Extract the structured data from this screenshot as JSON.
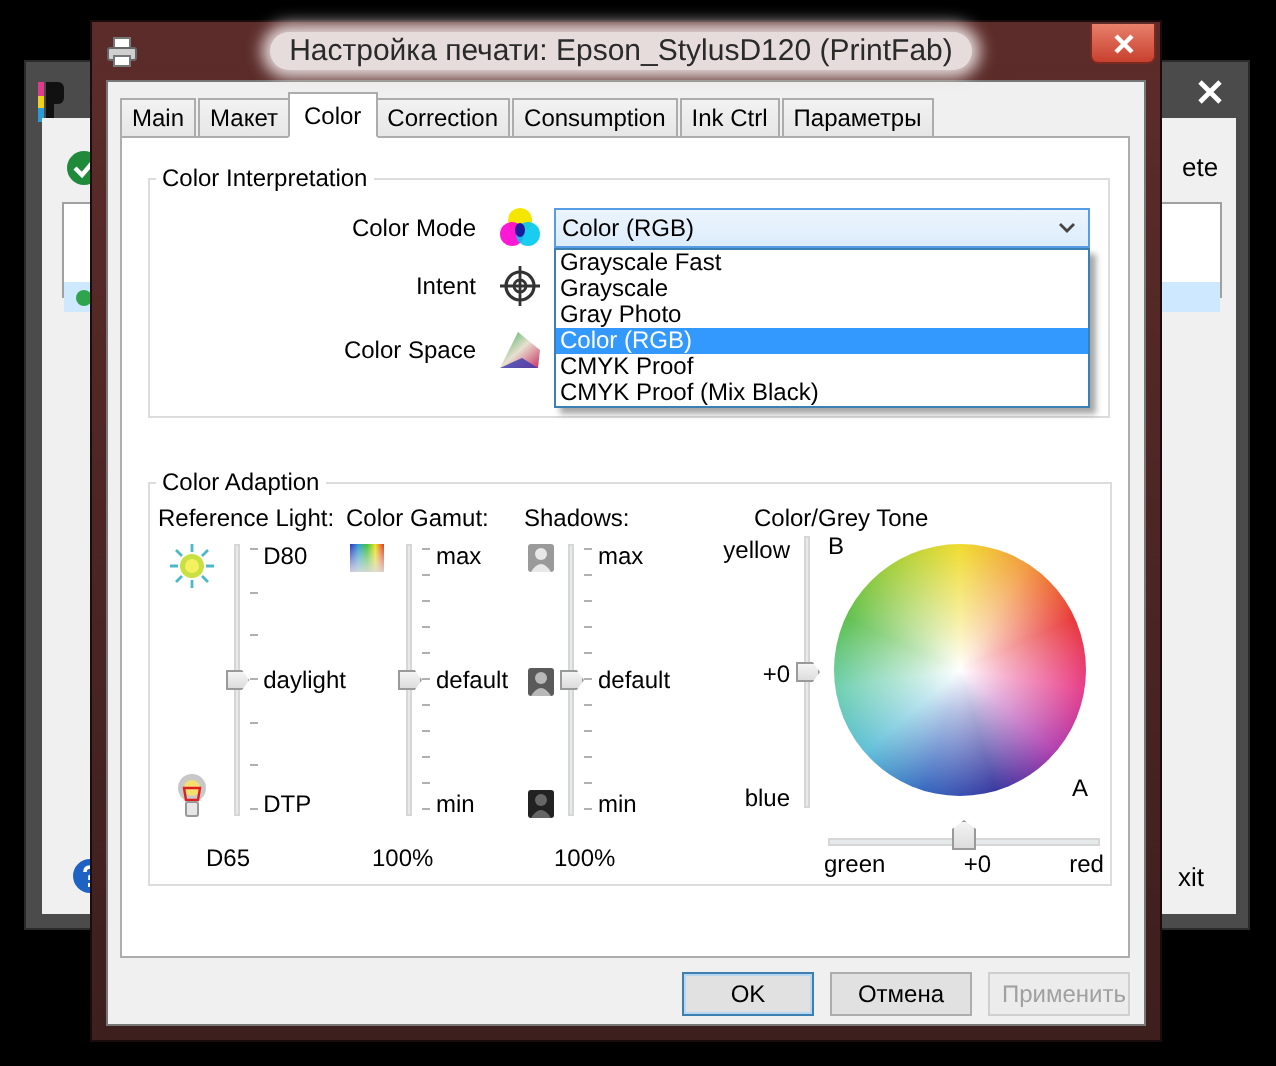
{
  "background_window": {
    "top_right_text": "ete",
    "bottom_right_text": "xit",
    "list_rows": [
      {
        "selected": false
      },
      {
        "selected": true
      },
      {
        "selected": false
      }
    ]
  },
  "window": {
    "title": "Настройка печати: Epson_StylusD120 (PrintFab)"
  },
  "tabs": [
    {
      "label": "Main",
      "selected": false
    },
    {
      "label": "Макет",
      "selected": false
    },
    {
      "label": "Color",
      "selected": true
    },
    {
      "label": "Correction",
      "selected": false
    },
    {
      "label": "Consumption",
      "selected": false
    },
    {
      "label": "Ink Ctrl",
      "selected": false
    },
    {
      "label": "Параметры",
      "selected": false
    }
  ],
  "color_interpretation": {
    "title": "Color Interpretation",
    "fields": [
      {
        "label": "Color Mode",
        "kind": "dropdown",
        "value": "Color (RGB)",
        "expanded": true,
        "options": [
          {
            "label": "Grayscale Fast",
            "selected": false
          },
          {
            "label": "Grayscale",
            "selected": false
          },
          {
            "label": "Gray Photo",
            "selected": false
          },
          {
            "label": "Color (RGB)",
            "selected": true
          },
          {
            "label": "CMYK Proof",
            "selected": false
          },
          {
            "label": "CMYK Proof (Mix Black)",
            "selected": false
          }
        ]
      },
      {
        "label": "Intent",
        "kind": "hidden"
      },
      {
        "label": "Color Space",
        "kind": "hidden"
      }
    ]
  },
  "color_adaption": {
    "title": "Color Adaption",
    "sliders": [
      {
        "label": "Reference Light:",
        "level": 0.5,
        "ticks": [
          "D80",
          "daylight",
          "DTP"
        ],
        "reading": "D65"
      },
      {
        "label": "Color Gamut:",
        "level": 0.5,
        "ticks": [
          "max",
          "default",
          "min"
        ],
        "reading": "100%"
      },
      {
        "label": "Shadows:",
        "level": 0.5,
        "ticks": [
          "max",
          "default",
          "min"
        ],
        "reading": "100%"
      }
    ],
    "tone": {
      "label": "Color/Grey Tone",
      "b_axis": {
        "name": "B",
        "ticks": [
          "yellow",
          "+0",
          "blue"
        ],
        "level": 0.5
      },
      "a_axis": {
        "name": "A",
        "ticks": [
          "green",
          "+0",
          "red"
        ],
        "level": 0.5
      }
    }
  },
  "buttons": [
    {
      "label": "OK",
      "default": true,
      "disabled": false
    },
    {
      "label": "Отмена",
      "default": false,
      "disabled": false
    },
    {
      "label": "Применить",
      "default": false,
      "disabled": true
    }
  ]
}
